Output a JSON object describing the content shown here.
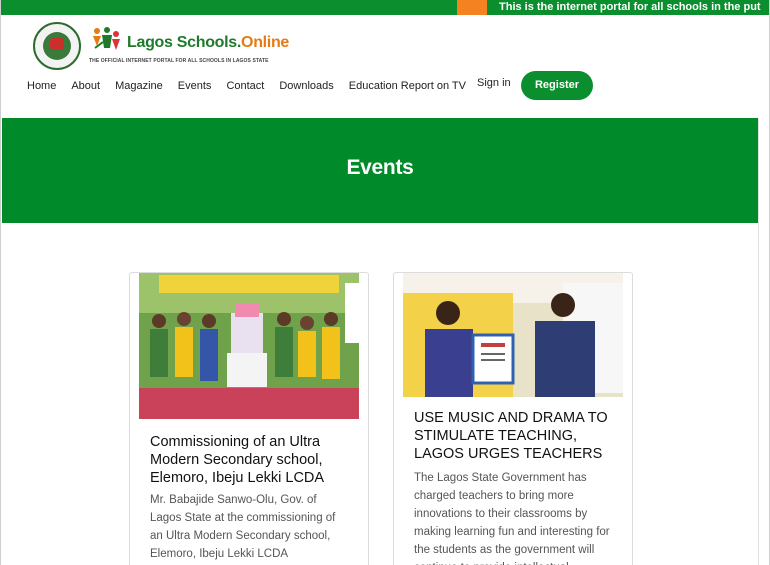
{
  "ticker": {
    "text": "This is the internet portal for all schools in the put"
  },
  "brand": {
    "name_main": "Lagos Schools.",
    "name_accent": "Online",
    "tagline": "THE OFFICIAL INTERNET PORTAL FOR ALL SCHOOLS IN LAGOS STATE"
  },
  "nav": {
    "items": [
      {
        "label": "Home"
      },
      {
        "label": "About"
      },
      {
        "label": "Magazine"
      },
      {
        "label": "Events"
      },
      {
        "label": "Contact"
      },
      {
        "label": "Downloads"
      },
      {
        "label": "Education Report on TV"
      }
    ],
    "signin": "Sign in",
    "register": "Register"
  },
  "hero": {
    "title": "Events"
  },
  "events": [
    {
      "title": "Commissioning of an Ultra Modern Secondary school, Elemoro, Ibeju Lekki LCDA",
      "excerpt": "Mr. Babajide Sanwo-Olu, Gov. of Lagos State at the commissioning of an Ultra Modern Secondary school, Elemoro, Ibeju Lekki LCDA"
    },
    {
      "title": "Use Music and Drama to stimulate teaching, Lagos urges teachers",
      "excerpt": "The Lagos State Government has charged teachers to bring more innovations to their classrooms by making learning fun and interesting for the students as the government will continue to provide intellectual"
    }
  ],
  "colors": {
    "primary_green": "#008a2a",
    "accent_orange": "#f58220",
    "register_button": "#0b8f2e"
  }
}
